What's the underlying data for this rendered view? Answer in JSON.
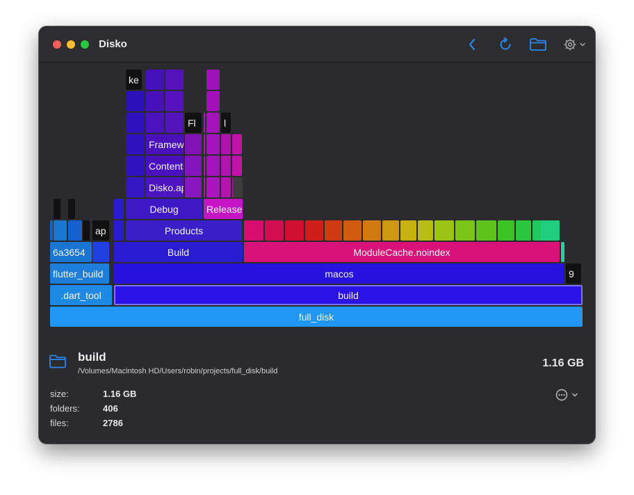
{
  "window": {
    "title": "Disko"
  },
  "colors": {
    "accent": "#2d86f0",
    "close": "#fe5f57",
    "minimize": "#febc2e",
    "zoom": "#28c840"
  },
  "toolbar": {
    "back_icon": "chevron-left-icon",
    "refresh_icon": "refresh-icon",
    "folder_icon": "folder-icon",
    "settings_icon": "gear-icon"
  },
  "chart": {
    "labels": {
      "full_disk": "full_disk",
      "dart_tool": ".dart_tool",
      "build": "build",
      "flutter_build": "flutter_build",
      "macos": "macos",
      "hash": "6a3654",
      "build_inner": "Build",
      "module_cache": "ModuleCache.noindex",
      "products": "Products",
      "ap": "ap",
      "debug": "Debug",
      "release": "Release",
      "disko_app": "Disko.app",
      "contents": "Contents",
      "frameworks": "Frameworks",
      "fl": "Fl",
      "ke": "ke",
      "nine": "9",
      "l": "l"
    }
  },
  "info": {
    "name": "build",
    "path": "/Volumes/Macintosh HD/Users/robin/projects/full_disk/build",
    "total_size": "1.16 GB",
    "size_label": "size:",
    "size_value": "1.16 GB",
    "folders_label": "folders:",
    "folders_value": "406",
    "files_label": "files:",
    "files_value": "2786",
    "more_icon": "more-icon"
  }
}
